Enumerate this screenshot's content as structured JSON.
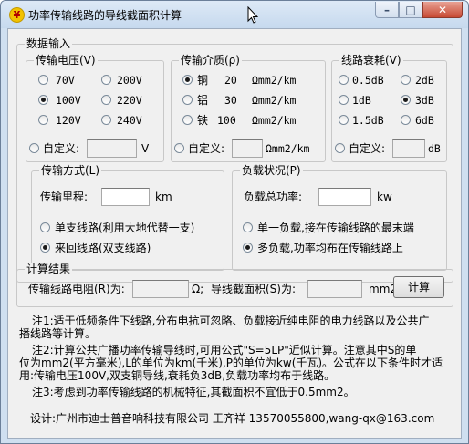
{
  "window": {
    "title": "功率传输线路的导线截面积计算",
    "icon_glyph": "¥",
    "min_glyph": "–",
    "max_glyph": "□",
    "close_glyph": "✕"
  },
  "data_input": {
    "label": "数据输入",
    "voltage": {
      "label": "传输电压(V)",
      "options": [
        "70V",
        "100V",
        "120V",
        "200V",
        "220V",
        "240V"
      ],
      "selected": "100V",
      "custom_label": "自定义:",
      "custom_value": "",
      "unit": "V"
    },
    "medium": {
      "label": "传输介质(ρ)",
      "options": [
        {
          "metal": "铜",
          "value": "20",
          "unit": "Ωmm2/km"
        },
        {
          "metal": "铝",
          "value": "30",
          "unit": "Ωmm2/km"
        },
        {
          "metal": "铁",
          "value": "100",
          "unit": "Ωmm2/km"
        }
      ],
      "selected": "铜",
      "custom_label": "自定义:",
      "custom_value": "",
      "unit": "Ωmm2/km"
    },
    "attenuation": {
      "label": "线路衰耗(V)",
      "options": [
        "0.5dB",
        "1dB",
        "1.5dB",
        "2dB",
        "3dB",
        "6dB"
      ],
      "selected": "3dB",
      "custom_label": "自定义:",
      "custom_value": "",
      "unit": "dB"
    },
    "method": {
      "label": "传输方式(L)",
      "distance_label": "传输里程:",
      "distance_value": "",
      "distance_unit": "km",
      "options": [
        "单支线路(利用大地代替一支)",
        "来回线路(双支线路)"
      ],
      "selected": "来回线路(双支线路)"
    },
    "load": {
      "label": "负载状况(P)",
      "power_label": "负载总功率:",
      "power_value": "",
      "power_unit": "kw",
      "options": [
        "单一负载,接在传输线路的最末端",
        "多负载,功率均布在传输线路上"
      ],
      "selected": "多负载,功率均布在传输线路上"
    }
  },
  "result": {
    "label": "计算结果",
    "resistance_label": "传输线路电阻(R)为:",
    "resistance_value": "",
    "resistance_unit": "Ω;",
    "area_label": "导线截面积(S)为:",
    "area_value": "",
    "area_unit": "mm2",
    "calc_button": "计算"
  },
  "notes": {
    "n1_line1": "注1:适于低频条件下线路,分布电抗可忽略、负载接近纯电阻的电力线路以及公共广",
    "n1_line2": "播线路等计算。",
    "n2_line1": "注2:计算公共广播功率传输导线时,可用公式\"S=5LP\"近似计算。注意其中S的单",
    "n2_line2": "位为mm2(平方毫米),L的单位为km(千米),P的单位为kw(千瓦)。公式在以下条件时才适",
    "n2_line3": "用:传输电压100V,双支铜导线,衰耗负3dB,负载功率均布于线路。",
    "n3": "注3:考虑到功率传输线路的机械特征,其截面积不宜低于0.5mm2。",
    "credit": "设计:广州市迪士普音响科技有限公司 王齐祥 13570055800,wang-qx@163.com"
  }
}
